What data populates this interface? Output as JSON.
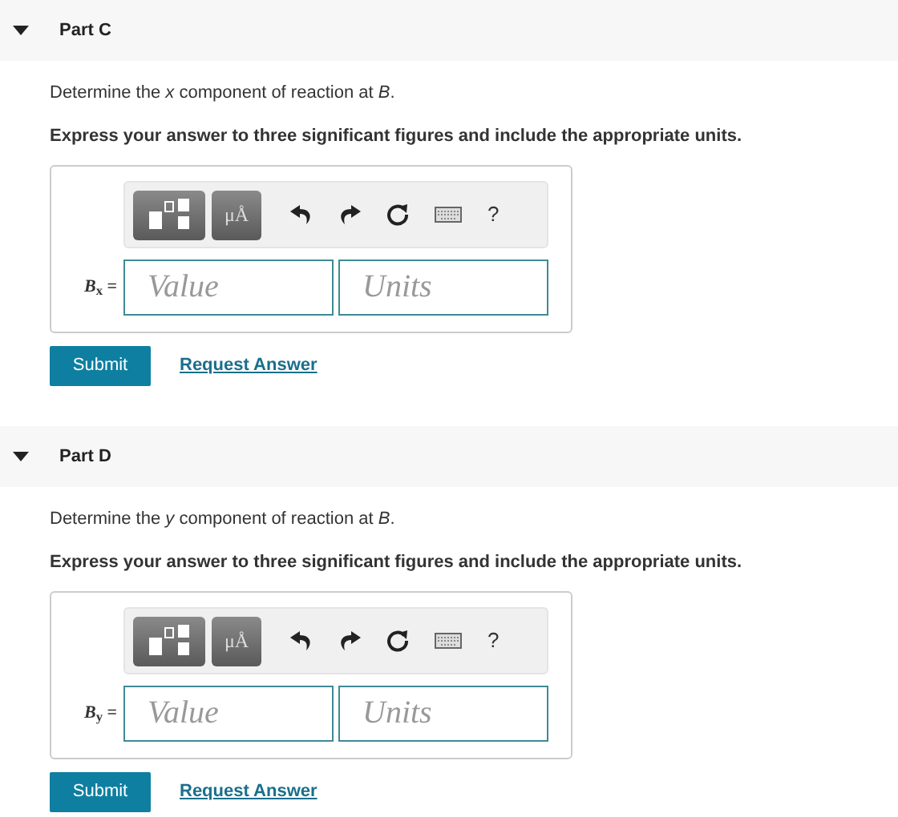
{
  "parts": [
    {
      "title": "Part C",
      "expanded": true,
      "prompt": "Determine the *x* component of reaction at *B*.",
      "instruction": "Express your answer to three significant figures and include the appropriate units.",
      "toolbar": {
        "symbols_label": "μÅ",
        "help_label": "?"
      },
      "answer_label": "*B*$_{x}$ =",
      "value_placeholder": "Value",
      "units_placeholder": "Units",
      "submit": "Submit",
      "request": "Request Answer"
    },
    {
      "title": "Part D",
      "expanded": true,
      "prompt": "Determine the *y* component of reaction at *B*.",
      "instruction": "Express your answer to three significant figures and include the appropriate units.",
      "toolbar": {
        "symbols_label": "μÅ",
        "help_label": "?"
      },
      "answer_label": "*B*$_{y}$ =",
      "value_placeholder": "Value",
      "units_placeholder": "Units",
      "submit": "Submit",
      "request": "Request Answer"
    }
  ]
}
